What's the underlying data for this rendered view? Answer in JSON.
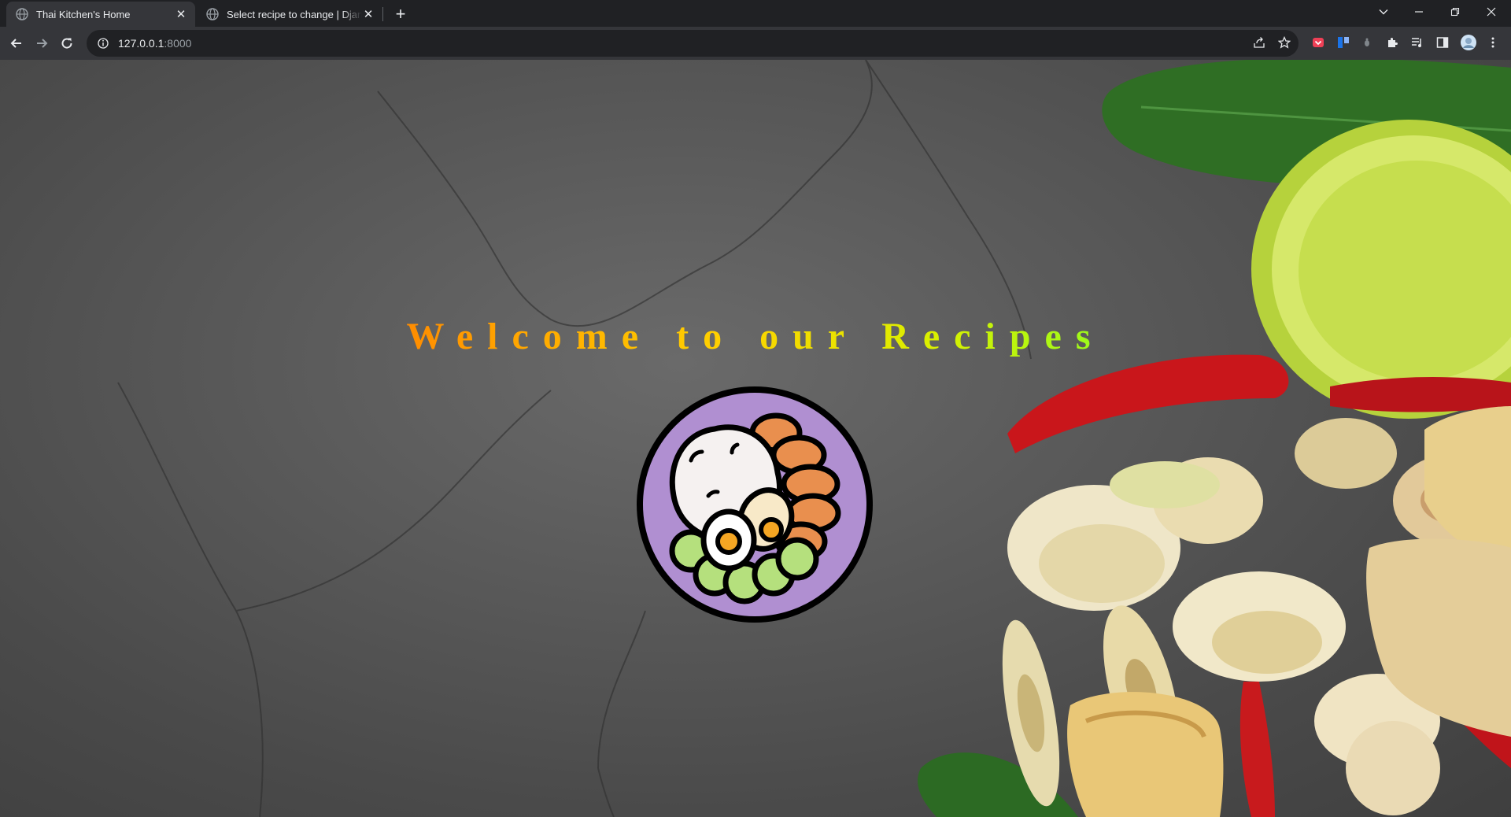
{
  "tabs": [
    {
      "title": "Thai Kitchen's Home",
      "active": true
    },
    {
      "title": "Select recipe to change | Django site admin",
      "active": false
    }
  ],
  "address": {
    "host": "127.0.0.1",
    "port": ":8000"
  },
  "page": {
    "heading": "Welcome to our Recipes",
    "logo_icon": "thai-rice-plate-icon"
  }
}
